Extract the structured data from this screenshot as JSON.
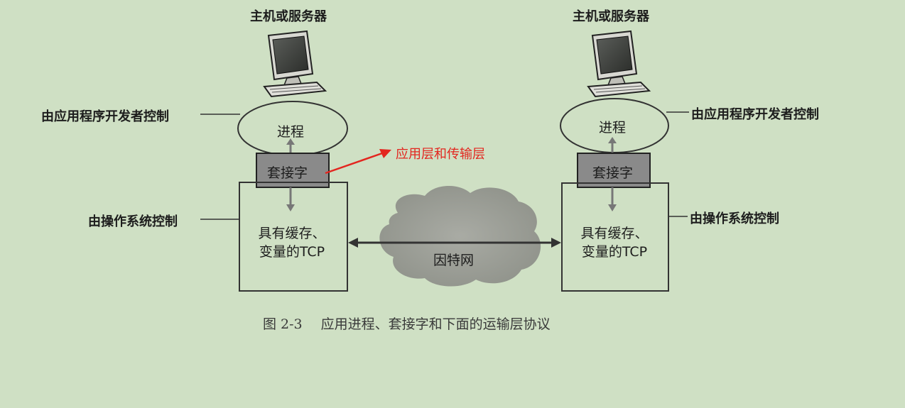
{
  "figure": {
    "left_host": {
      "host_label": "主机或服务器",
      "process": "进程",
      "socket": "套接字",
      "tcp_line1": "具有缓存、",
      "tcp_line2": "变量的TCP",
      "developer_label": "由应用程序开发者控制",
      "os_label": "由操作系统控制"
    },
    "right_host": {
      "host_label": "主机或服务器",
      "process": "进程",
      "socket": "套接字",
      "tcp_line1": "具有缓存、",
      "tcp_line2": "变量的TCP",
      "developer_label": "由应用程序开发者控制",
      "os_label": "由操作系统控制"
    },
    "network_label": "因特网",
    "annotation": "应用层和传输层",
    "annotation_color": "#e3261f",
    "socket_color": "#8a8a8a",
    "caption_number": "图 2-3",
    "caption_text": "应用进程、套接字和下面的运输层协议"
  }
}
